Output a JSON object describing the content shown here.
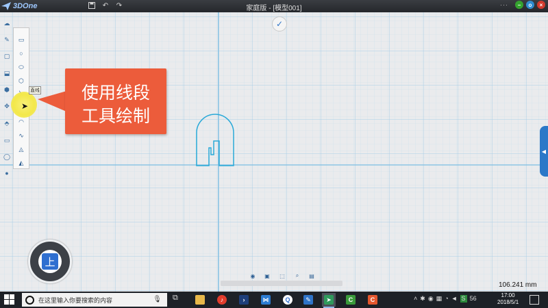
{
  "app": {
    "logo_text": "3DOne",
    "title": "家庭版 - [模型001]",
    "window_controls_menu": "···"
  },
  "toolbar_icons": [
    "save-icon",
    "undo-icon",
    "redo-icon"
  ],
  "callout": {
    "line1": "使用线段",
    "line2": "工具绘制"
  },
  "tooltip": "直线",
  "view": {
    "label": "上"
  },
  "status": {
    "measurement": "106.241 mm"
  },
  "taskbar": {
    "search_placeholder": "在这里输入你要搜索的内容",
    "time": "17:00",
    "date": "2018/5/1",
    "tray_badge": "56"
  },
  "colors": {
    "accent": "#2b78c8",
    "callout": "#ec5c3b",
    "sketch": "#29a9d8",
    "grid": "#a9cfe6",
    "highlight": "#f3e84a"
  }
}
